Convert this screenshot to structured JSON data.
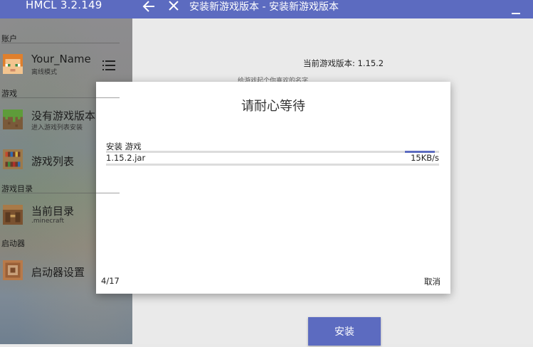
{
  "titlebar": {
    "app_title": "HMCL 3.2.149",
    "page_title": "安装新游戏版本 - 安装新游戏版本",
    "accent_color": "#5c6bc0"
  },
  "sidebar": {
    "sections": {
      "account": "账户",
      "game": "游戏",
      "game_dir": "游戏目录",
      "launcher": "启动器"
    },
    "account": {
      "name": "Your_Name",
      "mode": "离线模式"
    },
    "items": {
      "no_version": {
        "label": "没有游戏版本",
        "sub": "进入游戏列表安装"
      },
      "game_list": {
        "label": "游戏列表"
      },
      "current_dir": {
        "label": "当前目录",
        "sub": ".minecraft"
      },
      "launcher_settings": {
        "label": "启动器设置"
      }
    }
  },
  "main": {
    "current_version": "当前游戏版本: 1.15.2",
    "hint": "给游戏起个你喜欢的名字",
    "install_label": "安装"
  },
  "dialog": {
    "title": "请耐心等待",
    "task_label": "安装 游戏",
    "task_progress": 0.1,
    "file_name": "1.15.2.jar",
    "file_speed": "15KB/s",
    "step_counter": "4/17",
    "cancel_label": "取消"
  }
}
